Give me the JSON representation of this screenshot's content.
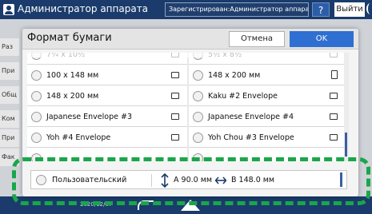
{
  "top_bar": {
    "title": "Администратор аппарата",
    "login_status": "Зарегистрирован:Администратор аппарат",
    "help_label": "?",
    "logout_label": "Выйти"
  },
  "background": {
    "tabs": [
      "Раз",
      "При",
      "Общ",
      "Ком",
      "При",
      "Фак"
    ],
    "date": "2020/12/07"
  },
  "dialog": {
    "title": "Формат бумаги",
    "cancel_label": "Отмена",
    "ok_label": "OK",
    "items": [
      {
        "label": "7¼ x 10½",
        "orientation": "landscape"
      },
      {
        "label": "5½ x 8½",
        "orientation": "landscape"
      },
      {
        "label": "100 x 148 мм",
        "orientation": "landscape"
      },
      {
        "label": "148 x 200 мм",
        "orientation": "portrait"
      },
      {
        "label": "148 x 200 мм",
        "orientation": "landscape"
      },
      {
        "label": "Kaku #2 Envelope",
        "orientation": "landscape"
      },
      {
        "label": "Japanese Envelope #3",
        "orientation": "landscape"
      },
      {
        "label": "Japanese Envelope #4",
        "orientation": "landscape"
      },
      {
        "label": "Yoh #4 Envelope",
        "orientation": "landscape"
      },
      {
        "label": "Yoh Chou #3 Envelope",
        "orientation": "landscape"
      }
    ],
    "custom": {
      "label": "Пользовательский",
      "dim_a": "A 90.0 мм",
      "dim_b": "B 148.0 мм"
    }
  },
  "colors": {
    "accent": "#2f6fd1",
    "highlight": "#1aa64a",
    "top_bar": "#1a3b6b"
  }
}
